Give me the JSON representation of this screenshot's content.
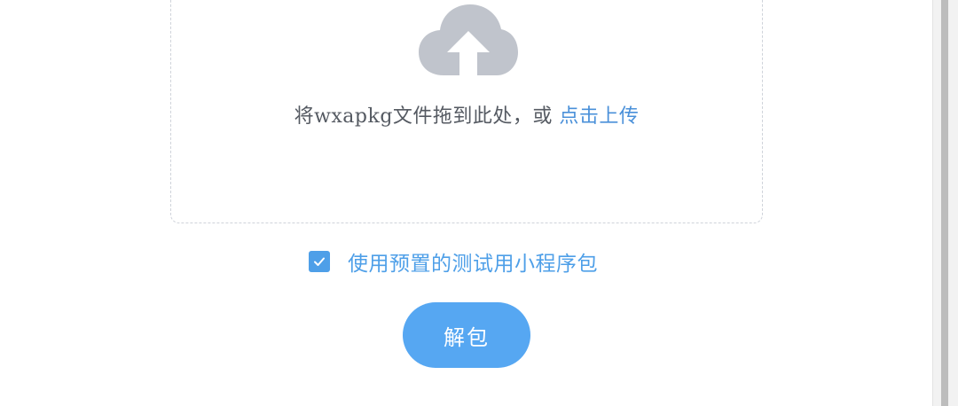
{
  "upload": {
    "icon": "cloud-upload-icon",
    "prompt_text": "将wxapkg文件拖到此处，或 ",
    "link_text": "点击上传"
  },
  "options": {
    "use_preset_label": "使用预置的测试用小程序包",
    "use_preset_checked": true
  },
  "actions": {
    "unpack_label": "解包"
  },
  "colors": {
    "accent": "#4e9fe8",
    "button": "#56a7f2",
    "icon_gray": "#c0c4cc",
    "text": "#555a62"
  }
}
